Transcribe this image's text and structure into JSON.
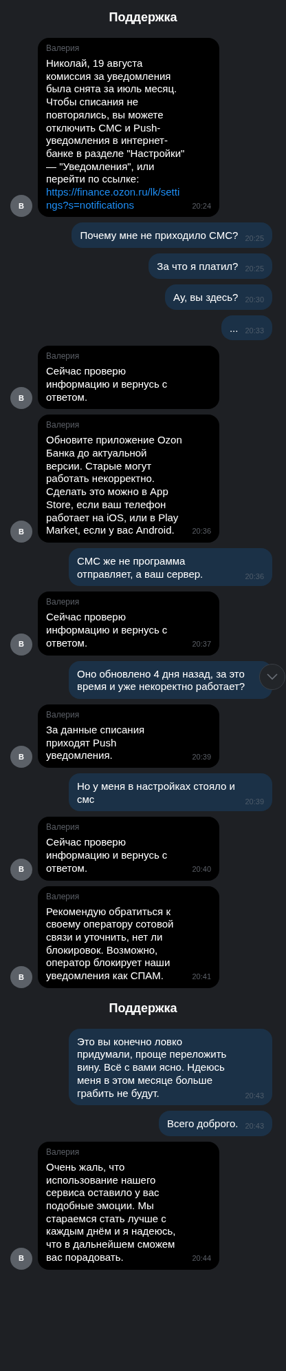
{
  "messages": [
    {
      "kind": "header",
      "text": "Поддержка"
    },
    {
      "kind": "incoming",
      "avatar": "В",
      "sender": "Валерия",
      "text": "Николай, 19 августа комиссия за уведомления была снята за июль месяц. Чтобы списания не повторялись, вы можете отключить СМС и Push-уведомления в интернет-банке в разделе \"Настройки\" — \"Уведомления\", или перейти по ссылке:",
      "link": "https://finance.ozon.ru/lk/settings?s=notifications",
      "time": "20:24"
    },
    {
      "kind": "outgoing",
      "text": "Почему мне не приходило СМС?",
      "time": "20:25"
    },
    {
      "kind": "outgoing",
      "text": "За что я платил?",
      "time": "20:25"
    },
    {
      "kind": "outgoing",
      "text": "Ау, вы здесь?",
      "time": "20:30"
    },
    {
      "kind": "outgoing",
      "text": "...",
      "time": "20:33"
    },
    {
      "kind": "incoming",
      "avatar": "В",
      "sender": "Валерия",
      "text": "Сейчас проверю информацию и вернусь с ответом."
    },
    {
      "kind": "incoming",
      "avatar": "В",
      "sender": "Валерия",
      "text": "Обновите приложение Ozon Банка до актуальной версии. Старые могут работать некорректно. Сделать это можно в App Store, если ваш телефон работает на iOS, или в Play Market, если у вас Android.",
      "time": "20:36"
    },
    {
      "kind": "outgoing",
      "text": "СМС же не программа отправляет, а ваш сервер.",
      "time": "20:36"
    },
    {
      "kind": "incoming",
      "avatar": "В",
      "sender": "Валерия",
      "text": "Сейчас проверю информацию и вернусь с ответом.",
      "time": "20:37"
    },
    {
      "kind": "outgoing",
      "text": "Оно обновлено 4 дня назад, за это время и уже некоректно работает?",
      "scroll_down_button": true
    },
    {
      "kind": "incoming",
      "avatar": "В",
      "sender": "Валерия",
      "text": "За данные списания приходят Push уведомления.",
      "time": "20:39"
    },
    {
      "kind": "outgoing",
      "text": "Но у меня в настройках стояло и смс",
      "time": "20:39"
    },
    {
      "kind": "incoming",
      "avatar": "В",
      "sender": "Валерия",
      "text": "Сейчас проверю информацию и вернусь с ответом.",
      "time": "20:40"
    },
    {
      "kind": "incoming",
      "avatar": "В",
      "sender": "Валерия",
      "text": "Рекомендую обратиться к своему оператору сотовой связи и уточнить, нет ли блокировок. Возможно, оператор блокирует наши уведомления как СПАМ.",
      "time": "20:41"
    },
    {
      "kind": "header",
      "text": "Поддержка"
    },
    {
      "kind": "outgoing",
      "text": "Это вы конечно ловко придумали, проще переложить вину. Всё с вами ясно. Ндеюсь меня в этом месяце больше грабить не будут.",
      "time": "20:43"
    },
    {
      "kind": "outgoing",
      "text": "Всего доброго.",
      "time": "20:43"
    },
    {
      "kind": "incoming",
      "avatar": "В",
      "sender": "Валерия",
      "text": "Очень жаль, что использование нашего сервиса оставило у вас подобные эмоции. Мы стараемся стать лучше с каждым днём и я надеюсь, что в дальнейшем сможем вас порадовать.",
      "time": "20:44"
    }
  ]
}
